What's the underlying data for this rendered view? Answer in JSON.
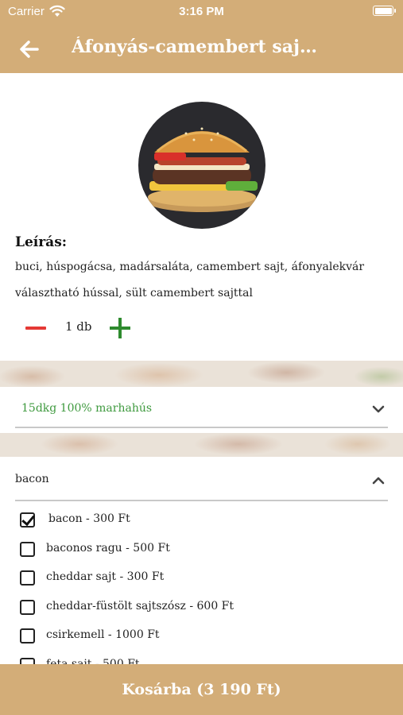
{
  "status": {
    "carrier": "Carrier",
    "time": "3:16 PM"
  },
  "nav": {
    "title": "Áfonyás-camembert saj…",
    "back_icon": "back-arrow-icon"
  },
  "product": {
    "description_heading": "Leírás:",
    "description_line1": "buci, húspogácsa, madársaláta, camembert sajt, áfonyalekvár",
    "description_line2": "választható hússal, sült camembert sajttal",
    "quantity": "1 db"
  },
  "meat_select": {
    "selected": "15dkg 100% marhahús"
  },
  "extras": {
    "title": "bacon",
    "options": [
      {
        "label": "bacon - 300 Ft",
        "checked": true
      },
      {
        "label": "baconos ragu - 500 Ft",
        "checked": false
      },
      {
        "label": "cheddar sajt - 300 Ft",
        "checked": false
      },
      {
        "label": "cheddar-füstölt sajtszósz - 600 Ft",
        "checked": false
      },
      {
        "label": "csirkemell - 1000 Ft",
        "checked": false
      },
      {
        "label": "feta sajt - 500 Ft",
        "checked": false
      }
    ]
  },
  "cart_button": {
    "label": "Kosárba (3 190 Ft)"
  },
  "colors": {
    "brand": "#d3ad78",
    "accent_green": "#3f9a3f",
    "minus_red": "#e53935",
    "plus_green": "#2e8b2e"
  }
}
